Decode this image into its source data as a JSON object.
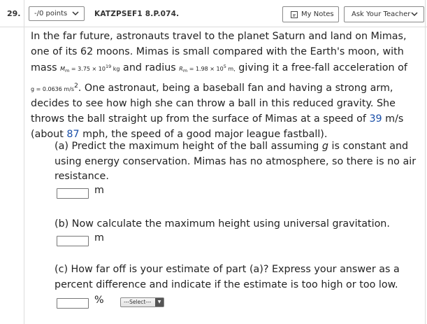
{
  "header": {
    "question_number": "29.",
    "points_label": "-/0 points",
    "question_id": "KATZPSEF1 8.P.074.",
    "my_notes_label": "My Notes",
    "ask_teacher_label": "Ask Your Teacher"
  },
  "problem": {
    "line1": "In the far future, astronauts travel to the planet Saturn and land on Mimas,",
    "line2": "one of its 62 moons. Mimas is small compared with the Earth's moon, with",
    "line3_a": "mass ",
    "mass_sym": "M",
    "mass_sub": "m",
    "mass_val": " = 3.75 × 10",
    "mass_exp": "19",
    "mass_unit": " kg",
    "line3_b": " and radius ",
    "radius_sym": "R",
    "radius_sub": "m",
    "radius_val": " = 1.98 × 10",
    "radius_exp": "5",
    "radius_unit": " m,",
    "line3_c": " giving it a free-fall acceleration of",
    "g_expr": "g = 0.0636 m/s",
    "g_exp": "2",
    "line4_b": ". One astronaut, being a baseball fan and having a strong arm,",
    "line5": "decides to see how high she can throw a ball in this reduced gravity. She",
    "line6_a": "throws the ball straight up from the surface of Mimas at a speed of ",
    "speed": "39",
    "line6_b": " m/s",
    "line7_a": "(about ",
    "mph": "87",
    "line7_b": " mph, the speed of a good major league fastball)."
  },
  "part_a": {
    "line1_a": "(a) Predict the maximum height of the ball assuming ",
    "g_var": "g",
    "line1_b": " is constant and",
    "line2": "using energy conservation. Mimas has no atmosphere, so there is no air",
    "line3": "resistance.",
    "unit": "m"
  },
  "part_b": {
    "line1": "(b) Now calculate the maximum height using universal gravitation.",
    "unit": "m"
  },
  "part_c": {
    "line1": "(c) How far off is your estimate of part (a)? Express your answer as a",
    "line2": "percent difference and indicate if the estimate is too high or too low.",
    "unit": "%",
    "select_value": "---Select---"
  }
}
